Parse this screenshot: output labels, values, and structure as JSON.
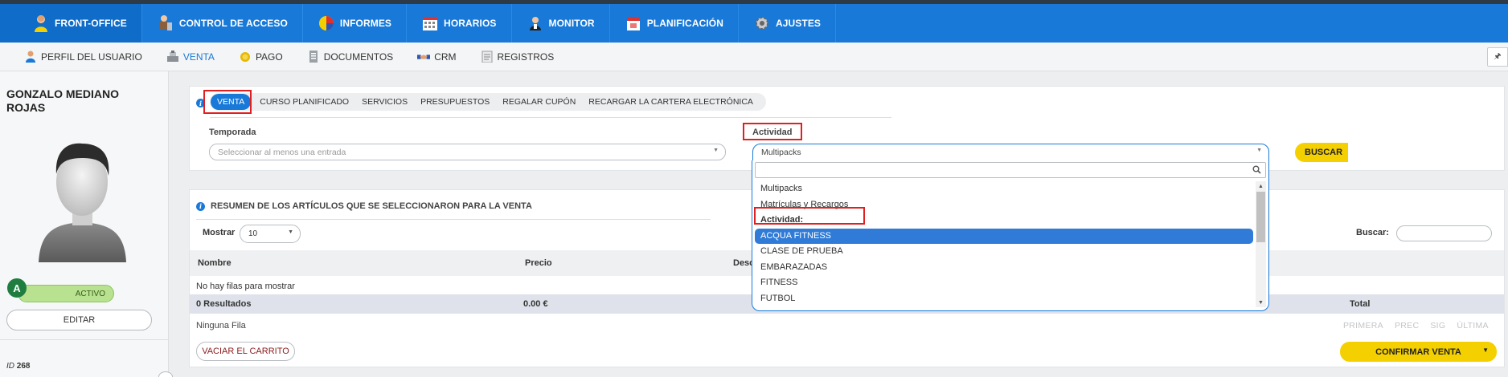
{
  "main_nav": {
    "tabs": [
      {
        "label": "FRONT-OFFICE",
        "icon": "person-user-icon",
        "active": true
      },
      {
        "label": "CONTROL DE ACCESO",
        "icon": "turnstile-icon",
        "active": false
      },
      {
        "label": "INFORMES",
        "icon": "pie-chart-icon",
        "active": false
      },
      {
        "label": "HORARIOS",
        "icon": "calendar-grid-icon",
        "active": false
      },
      {
        "label": "MONITOR",
        "icon": "monitor-person-icon",
        "active": false
      },
      {
        "label": "PLANIFICACIÓN",
        "icon": "calendar-icon",
        "active": false
      },
      {
        "label": "AJUSTES",
        "icon": "gear-icon",
        "active": false
      }
    ]
  },
  "sub_nav": {
    "tabs": [
      {
        "label": "PERFIL DEL USUARIO",
        "icon": "user-profile-icon",
        "active": false
      },
      {
        "label": "VENTA",
        "icon": "cash-register-icon",
        "active": true
      },
      {
        "label": "PAGO",
        "icon": "coin-icon",
        "active": false
      },
      {
        "label": "DOCUMENTOS",
        "icon": "document-icon",
        "active": false
      },
      {
        "label": "CRM",
        "icon": "handshake-icon",
        "active": false
      },
      {
        "label": "REGISTROS",
        "icon": "notepad-icon",
        "active": false
      }
    ],
    "pin_icon": "pin-icon"
  },
  "user": {
    "name": "GONZALO MEDIANO ROJAS",
    "badge_letter": "A",
    "status": "ACTIVO",
    "edit_label": "EDITAR",
    "id_label": "ID",
    "id_value": "268"
  },
  "sale_form": {
    "category_tabs": [
      "VENTA",
      "CURSO PLANIFICADO",
      "SERVICIOS",
      "PRESUPUESTOS",
      "REGALAR CUPÓN",
      "RECARGAR LA CARTERA ELECTRÓNICA"
    ],
    "selected_tab": "VENTA",
    "temporada_label": "Temporada",
    "temporada_placeholder": "Seleccionar al menos una entrada",
    "actividad_label": "Actividad",
    "actividad_value": "Multipacks",
    "search_button": "BUSCAR"
  },
  "dropdown": {
    "search_placeholder": "",
    "items": [
      {
        "label": "Multipacks",
        "type": "option",
        "highlighted": false
      },
      {
        "label": "Matrículas y Recargos",
        "type": "option",
        "highlighted": false
      },
      {
        "label": "Actividad:",
        "type": "group",
        "highlighted": false
      },
      {
        "label": "ACQUA FITNESS",
        "type": "option",
        "highlighted": true
      },
      {
        "label": "CLASE DE PRUEBA",
        "type": "option",
        "highlighted": false
      },
      {
        "label": "EMBARAZADAS",
        "type": "option",
        "highlighted": false
      },
      {
        "label": "FITNESS",
        "type": "option",
        "highlighted": false
      },
      {
        "label": "FUTBOL",
        "type": "option",
        "highlighted": false
      }
    ]
  },
  "summary": {
    "title": "RESUMEN DE LOS ARTÍCULOS QUE SE SELECCIONARON PARA LA VENTA",
    "show_label": "Mostrar",
    "show_value": "10",
    "search_label": "Buscar:",
    "columns": [
      "Nombre",
      "Precio",
      "Desc"
    ],
    "empty_text": "No hay filas para mostrar",
    "totals_label": "0 Resultados",
    "totals_price": "0.00 €",
    "total_column": "Total",
    "footer_text": "Ninguna Fila",
    "pager": [
      "PRIMERA",
      "PREC",
      "SIG",
      "ÚLTIMA"
    ],
    "clear_button": "VACIAR EL CARRITO",
    "confirm_button": "CONFIRMAR VENTA"
  },
  "colors": {
    "nav_blue": "#1879d8",
    "accent_yellow": "#f5d000",
    "status_green": "#b8e28f",
    "highlight_blue": "#2f7bd7",
    "annotation_red": "#e02020"
  }
}
